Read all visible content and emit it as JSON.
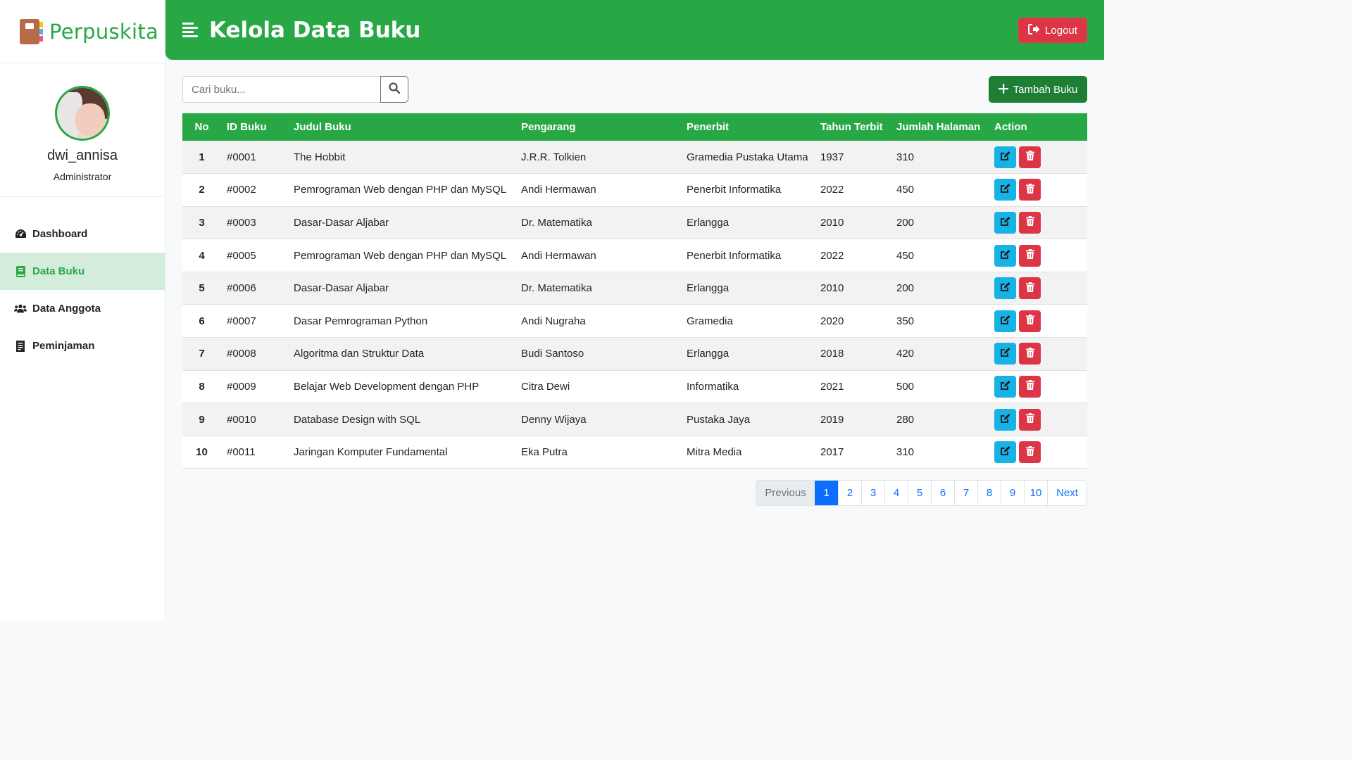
{
  "brand": {
    "name": "Perpuskita"
  },
  "profile": {
    "username": "dwi_annisa",
    "role": "Administrator"
  },
  "nav": [
    {
      "label": "Dashboard",
      "icon": "dashboard-icon"
    },
    {
      "label": "Data Buku",
      "icon": "book-icon"
    },
    {
      "label": "Data Anggota",
      "icon": "users-icon"
    },
    {
      "label": "Peminjaman",
      "icon": "receipt-icon"
    }
  ],
  "header": {
    "title": "Kelola Data Buku",
    "logout_label": "Logout"
  },
  "search": {
    "placeholder": "Cari buku..."
  },
  "toolbar": {
    "add_label": "Tambah Buku"
  },
  "table": {
    "headers": {
      "no": "No",
      "id": "ID Buku",
      "judul": "Judul Buku",
      "pengarang": "Pengarang",
      "penerbit": "Penerbit",
      "tahun": "Tahun Terbit",
      "jumlah": "Jumlah Halaman",
      "action": "Action"
    },
    "rows": [
      {
        "no": "1",
        "id": "#0001",
        "judul": "The Hobbit",
        "pengarang": "J.R.R. Tolkien",
        "penerbit": "Gramedia Pustaka Utama",
        "tahun": "1937",
        "jumlah": "310"
      },
      {
        "no": "2",
        "id": "#0002",
        "judul": "Pemrograman Web dengan PHP dan MySQL",
        "pengarang": "Andi Hermawan",
        "penerbit": "Penerbit Informatika",
        "tahun": "2022",
        "jumlah": "450"
      },
      {
        "no": "3",
        "id": "#0003",
        "judul": "Dasar-Dasar Aljabar",
        "pengarang": "Dr. Matematika",
        "penerbit": "Erlangga",
        "tahun": "2010",
        "jumlah": "200"
      },
      {
        "no": "4",
        "id": "#0005",
        "judul": "Pemrograman Web dengan PHP dan MySQL",
        "pengarang": "Andi Hermawan",
        "penerbit": "Penerbit Informatika",
        "tahun": "2022",
        "jumlah": "450"
      },
      {
        "no": "5",
        "id": "#0006",
        "judul": "Dasar-Dasar Aljabar",
        "pengarang": "Dr. Matematika",
        "penerbit": "Erlangga",
        "tahun": "2010",
        "jumlah": "200"
      },
      {
        "no": "6",
        "id": "#0007",
        "judul": "Dasar Pemrograman Python",
        "pengarang": "Andi Nugraha",
        "penerbit": "Gramedia",
        "tahun": "2020",
        "jumlah": "350"
      },
      {
        "no": "7",
        "id": "#0008",
        "judul": "Algoritma dan Struktur Data",
        "pengarang": "Budi Santoso",
        "penerbit": "Erlangga",
        "tahun": "2018",
        "jumlah": "420"
      },
      {
        "no": "8",
        "id": "#0009",
        "judul": "Belajar Web Development dengan PHP",
        "pengarang": "Citra Dewi",
        "penerbit": "Informatika",
        "tahun": "2021",
        "jumlah": "500"
      },
      {
        "no": "9",
        "id": "#0010",
        "judul": "Database Design with SQL",
        "pengarang": "Denny Wijaya",
        "penerbit": "Pustaka Jaya",
        "tahun": "2019",
        "jumlah": "280"
      },
      {
        "no": "10",
        "id": "#0011",
        "judul": "Jaringan Komputer Fundamental",
        "pengarang": "Eka Putra",
        "penerbit": "Mitra Media",
        "tahun": "2017",
        "jumlah": "310"
      }
    ]
  },
  "pagination": {
    "prev": "Previous",
    "pages": [
      "1",
      "2",
      "3",
      "4",
      "5",
      "6",
      "7",
      "8",
      "9",
      "10"
    ],
    "active": "1",
    "next": "Next"
  },
  "colors": {
    "primary": "#28a745",
    "danger": "#dc3545",
    "info": "#17b3e6",
    "link": "#0d6efd"
  }
}
